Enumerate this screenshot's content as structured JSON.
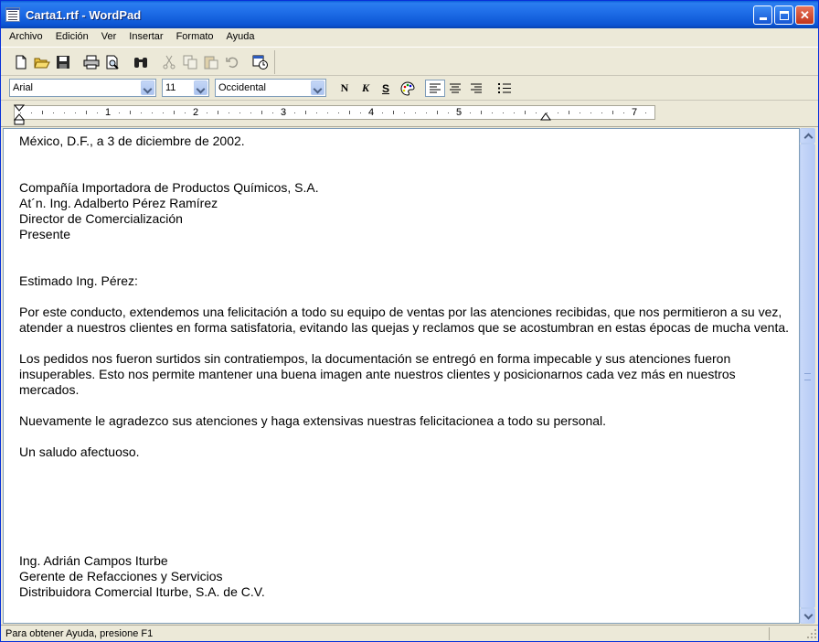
{
  "window": {
    "title": "Carta1.rtf - WordPad"
  },
  "menu": [
    "Archivo",
    "Edición",
    "Ver",
    "Insertar",
    "Formato",
    "Ayuda"
  ],
  "toolbar": {
    "icons": [
      "new-document-icon",
      "open-folder-icon",
      "save-icon",
      "print-icon",
      "print-preview-icon",
      "find-icon",
      "cut-icon",
      "copy-icon",
      "paste-icon",
      "undo-icon",
      "date-time-icon"
    ]
  },
  "format": {
    "font": "Arial",
    "size": "11",
    "script": "Occidental",
    "bold_label": "N",
    "italic_label": "K",
    "underline_label": "S"
  },
  "ruler": {
    "numbers": [
      "1",
      "2",
      "3",
      "4",
      "5",
      "7"
    ]
  },
  "document": {
    "lines": [
      "México, D.F., a 3 de diciembre de 2002.",
      "",
      "",
      "Compañía Importadora de Productos Químicos, S.A.",
      "At´n. Ing. Adalberto Pérez Ramírez",
      "Director de Comercialización",
      "Presente",
      "",
      "",
      "Estimado Ing. Pérez:",
      "",
      "Por este conducto, extendemos una felicitación a todo su equipo de ventas por las atenciones recibidas, que nos permitieron a su vez, atender a nuestros clientes en forma satisfatoria, evitando las quejas y reclamos que se acostumbran en estas épocas de mucha venta.",
      "",
      "Los pedidos nos fueron surtidos sin contratiempos, la documentación se entregó en forma impecable y sus atenciones fueron insuperables. Esto nos permite mantener una buena imagen ante nuestros clientes y posicionarnos cada vez más en nuestros mercados.",
      "",
      "Nuevamente le agradezco sus atenciones y haga extensivas nuestras felicitacionea a todo su personal.",
      "",
      "Un saludo afectuoso.",
      "",
      "",
      "",
      "",
      "",
      "",
      "Ing. Adrián Campos Iturbe",
      "Gerente de Refacciones y Servicios",
      "Distribuidora Comercial Iturbe, S.A. de C.V."
    ]
  },
  "status": {
    "text": "Para obtener Ayuda, presione F1"
  }
}
